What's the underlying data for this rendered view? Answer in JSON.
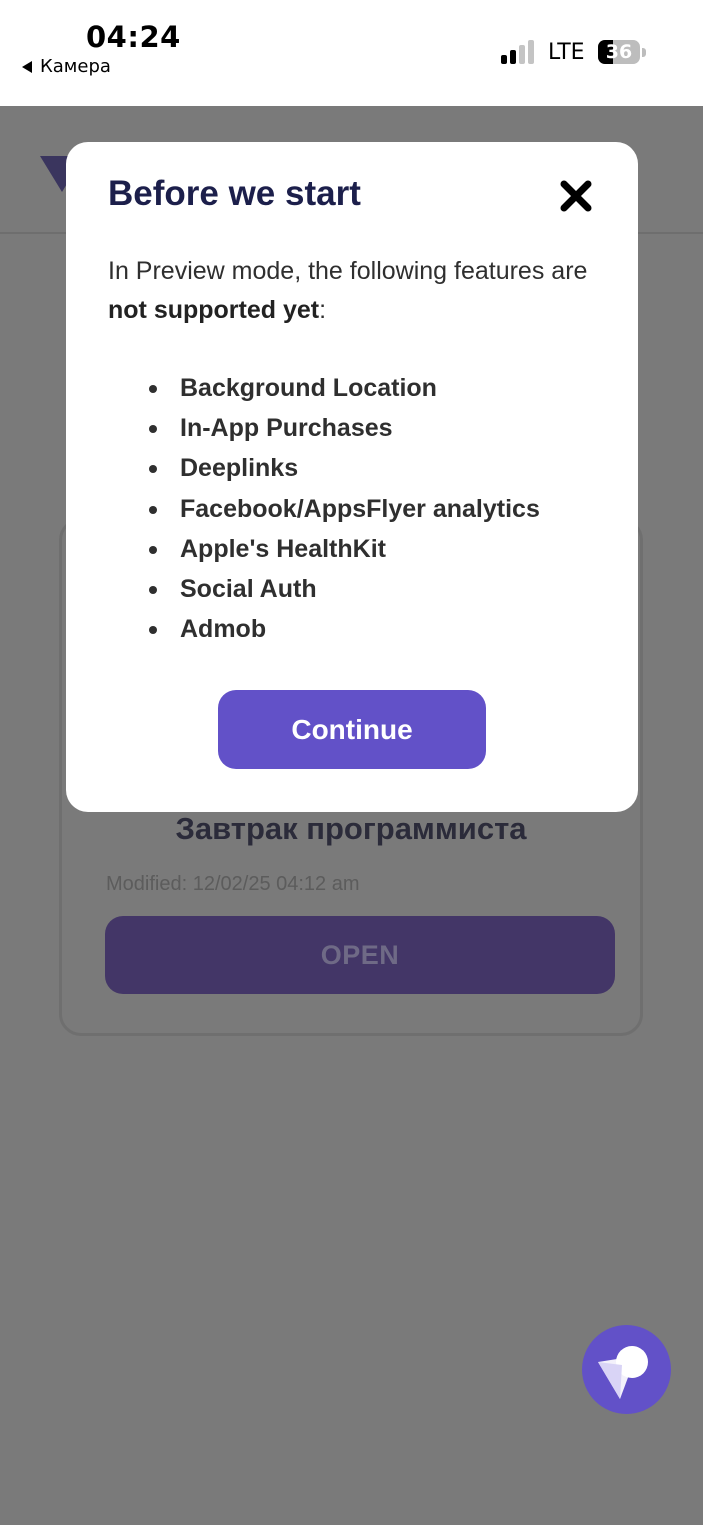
{
  "status_bar": {
    "time": "04:24",
    "back_label": "Камера",
    "network": "LTE",
    "battery_percent": "36",
    "battery_level": 0.36,
    "signal_bars_active": 2,
    "signal_bars_total": 4
  },
  "background_app": {
    "project_card": {
      "title": "Завтрак программиста",
      "modified": "Modified: 12/02/25 04:12 am",
      "open_label": "OPEN"
    }
  },
  "modal": {
    "title": "Before we start",
    "description_prefix": "In Preview mode, the following features are ",
    "description_bold": "not supported yet",
    "description_suffix": ":",
    "features": [
      "Background Location",
      "In-App Purchases",
      "Deeplinks",
      "Facebook/AppsFlyer analytics",
      "Apple's HealthKit",
      "Social Auth",
      "Admob"
    ],
    "continue_label": "Continue"
  },
  "colors": {
    "accent": "#6251c8",
    "title": "#1c1f4b",
    "overlay_background": "#7a7a7a",
    "signal_active": "#000000",
    "signal_inactive": "#c4c4c4"
  },
  "icons": {
    "back": "back-arrow-icon",
    "signal": "cellular-signal-icon",
    "battery": "battery-icon",
    "close": "close-icon",
    "fab": "fab-logo-icon"
  }
}
